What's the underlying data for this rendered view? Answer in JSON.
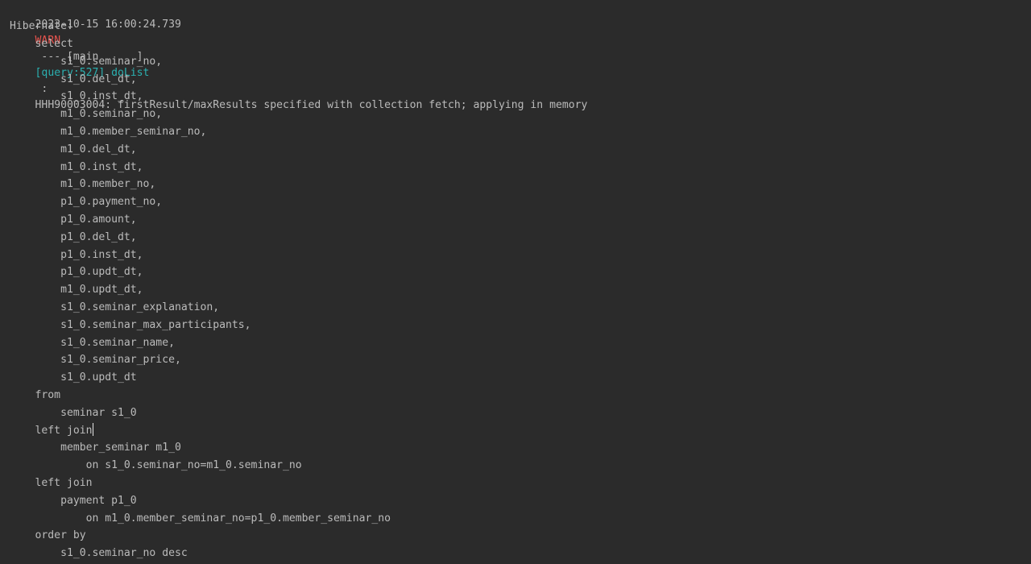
{
  "log": {
    "timestamp": "2023-10-15 16:00:24.739",
    "level": "WARN",
    "separator": " --- ",
    "thread": "[main      ]",
    "logger": "[query:527] doList",
    "colon": " : ",
    "message": "HHH90003004: firstResult/maxResults specified with collection fetch; applying in memory"
  },
  "sql": {
    "header": "Hibernate:",
    "lines": [
      "    select",
      "        s1_0.seminar_no,",
      "        s1_0.del_dt,",
      "        s1_0.inst_dt,",
      "        m1_0.seminar_no,",
      "        m1_0.member_seminar_no,",
      "        m1_0.del_dt,",
      "        m1_0.inst_dt,",
      "        m1_0.member_no,",
      "        p1_0.payment_no,",
      "        p1_0.amount,",
      "        p1_0.del_dt,",
      "        p1_0.inst_dt,",
      "        p1_0.updt_dt,",
      "        m1_0.updt_dt,",
      "        s1_0.seminar_explanation,",
      "        s1_0.seminar_max_participants,",
      "        s1_0.seminar_name,",
      "        s1_0.seminar_price,",
      "        s1_0.updt_dt",
      "    from",
      "        seminar s1_0",
      "    left join",
      "        member_seminar m1_0",
      "            on s1_0.seminar_no=m1_0.seminar_no",
      "    left join",
      "        payment p1_0",
      "            on m1_0.member_seminar_no=p1_0.member_seminar_no",
      "    order by",
      "        s1_0.seminar_no desc"
    ],
    "cursor_line": 22
  },
  "colors": {
    "background": "#2b2b2b",
    "text": "#bbbbbb",
    "warn": "#e8534d",
    "logger": "#2bb1b1"
  }
}
